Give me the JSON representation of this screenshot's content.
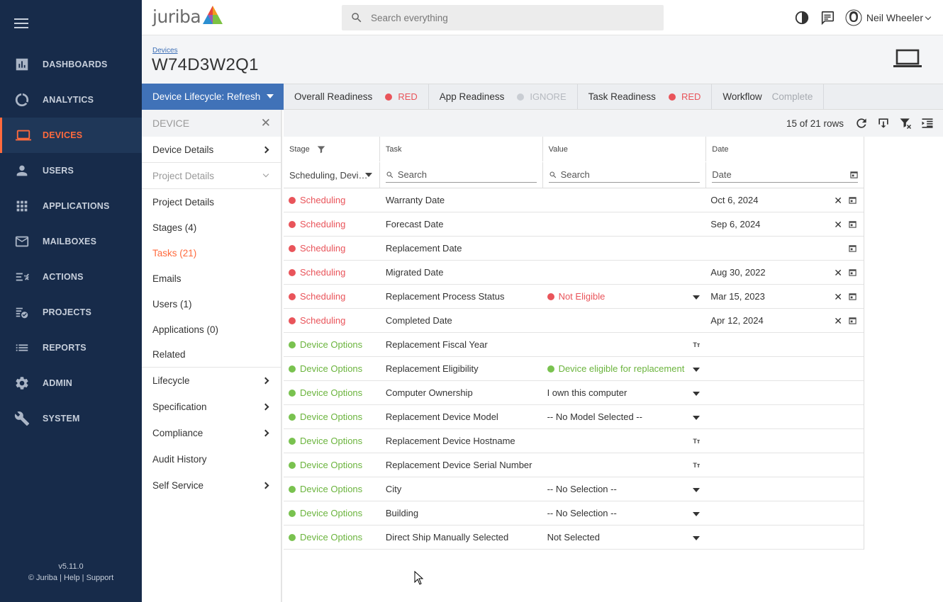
{
  "nav": {
    "items": [
      {
        "label": "DASHBOARDS",
        "icon": "dashboard-icon"
      },
      {
        "label": "ANALYTICS",
        "icon": "analytics-icon"
      },
      {
        "label": "DEVICES",
        "icon": "laptop-icon"
      },
      {
        "label": "USERS",
        "icon": "user-icon"
      },
      {
        "label": "APPLICATIONS",
        "icon": "apps-grid-icon"
      },
      {
        "label": "MAILBOXES",
        "icon": "mail-icon"
      },
      {
        "label": "ACTIONS",
        "icon": "actions-icon"
      },
      {
        "label": "PROJECTS",
        "icon": "projects-icon"
      },
      {
        "label": "REPORTS",
        "icon": "reports-icon"
      },
      {
        "label": "ADMIN",
        "icon": "gear-icon"
      },
      {
        "label": "SYSTEM",
        "icon": "wrench-icon"
      }
    ],
    "active": "DEVICES",
    "version": "v5.11.0",
    "footer_copy": "© Juriba",
    "footer_help": "Help",
    "footer_support": "Support"
  },
  "topbar": {
    "logo_text": "juriba",
    "search_placeholder": "Search everything",
    "user_name": "Neil Wheeler"
  },
  "header": {
    "breadcrumb": "Devices",
    "title": "W74D3W2Q1"
  },
  "readiness": {
    "lifecycle": "Device Lifecycle: Refresh",
    "overall_label": "Overall Readiness",
    "overall_status": "RED",
    "app_label": "App Readiness",
    "app_status": "IGNORE",
    "task_label": "Task Readiness",
    "task_status": "RED",
    "workflow_label": "Workflow",
    "workflow_status": "Complete"
  },
  "side": {
    "header": "DEVICE",
    "device_details": "Device Details",
    "project_details_group": "Project Details",
    "items": [
      "Project Details",
      "Stages (4)",
      "Tasks (21)",
      "Emails",
      "Users (1)",
      "Applications (0)",
      "Related"
    ],
    "active": "Tasks (21)",
    "lifecycle": "Lifecycle",
    "specification": "Specification",
    "compliance": "Compliance",
    "audit_history": "Audit History",
    "self_service": "Self Service"
  },
  "grid": {
    "row_count": "15 of 21 rows",
    "headers": {
      "stage": "Stage",
      "task": "Task",
      "value": "Value",
      "date": "Date"
    },
    "filters": {
      "stage": "Scheduling, Devi…",
      "task": "Search",
      "value": "Search",
      "date": "Date"
    },
    "rows": [
      {
        "stage": "Scheduling",
        "task": "Warranty Date",
        "value": "",
        "date": "Oct 6, 2024"
      },
      {
        "stage": "Scheduling",
        "task": "Forecast Date",
        "value": "",
        "date": "Sep 6, 2024"
      },
      {
        "stage": "Scheduling",
        "task": "Replacement Date",
        "value": "",
        "date": ""
      },
      {
        "stage": "Scheduling",
        "task": "Migrated Date",
        "value": "",
        "date": "Aug 30, 2022"
      },
      {
        "stage": "Scheduling",
        "task": "Replacement Process Status",
        "value": "Not Eligible",
        "date": "Mar 15, 2023"
      },
      {
        "stage": "Scheduling",
        "task": "Completed Date",
        "value": "",
        "date": "Apr 12, 2024"
      },
      {
        "stage": "Device Options",
        "task": "Replacement Fiscal Year",
        "value": "",
        "date": ""
      },
      {
        "stage": "Device Options",
        "task": "Replacement Eligibility",
        "value": "Device eligible for replacement",
        "date": ""
      },
      {
        "stage": "Device Options",
        "task": "Computer Ownership",
        "value": "I own this computer",
        "date": ""
      },
      {
        "stage": "Device Options",
        "task": "Replacement Device Model",
        "value": "-- No Model Selected --",
        "date": ""
      },
      {
        "stage": "Device Options",
        "task": "Replacement Device Hostname",
        "value": "",
        "date": ""
      },
      {
        "stage": "Device Options",
        "task": "Replacement Device Serial Number",
        "value": "",
        "date": ""
      },
      {
        "stage": "Device Options",
        "task": "City",
        "value": "-- No Selection --",
        "date": ""
      },
      {
        "stage": "Device Options",
        "task": "Building",
        "value": "-- No Selection --",
        "date": ""
      },
      {
        "stage": "Device Options",
        "task": "Direct Ship Manually Selected",
        "value": "Not Selected",
        "date": ""
      }
    ],
    "text_glyph": "Tт"
  },
  "colors": {
    "nav_bg": "#172b4a",
    "accent": "#ff6a3d",
    "primary": "#4072b8",
    "red": "#e9545a",
    "green": "#6bb43d"
  }
}
